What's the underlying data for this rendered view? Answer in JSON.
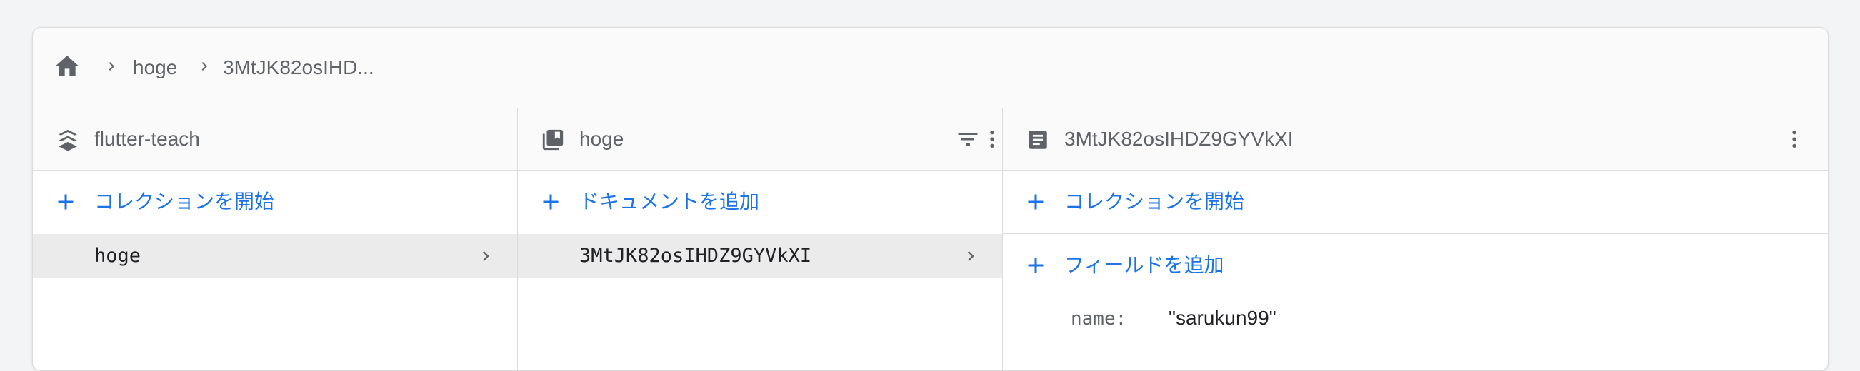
{
  "breadcrumb": {
    "items": [
      "hoge",
      "3MtJK82osIHD..."
    ]
  },
  "colors": {
    "accent": "#1a73e8",
    "icon": "#5f6368",
    "selected_row": "#ebebeb"
  },
  "columns": {
    "project": {
      "title": "flutter-teach",
      "icon": "firestore-stack-icon",
      "action_label": "コレクションを開始",
      "items": [
        {
          "label": "hoge",
          "selected": true
        }
      ]
    },
    "collection": {
      "title": "hoge",
      "icon": "collection-icon",
      "action_label": "ドキュメントを追加",
      "items": [
        {
          "label": "3MtJK82osIHDZ9GYVkXI",
          "selected": true
        }
      ]
    },
    "document": {
      "title": "3MtJK82osIHDZ9GYVkXI",
      "icon": "document-icon",
      "start_collection_label": "コレクションを開始",
      "add_field_label": "フィールドを追加",
      "fields": [
        {
          "key": "name:",
          "value": "\"sarukun99\""
        }
      ]
    }
  }
}
